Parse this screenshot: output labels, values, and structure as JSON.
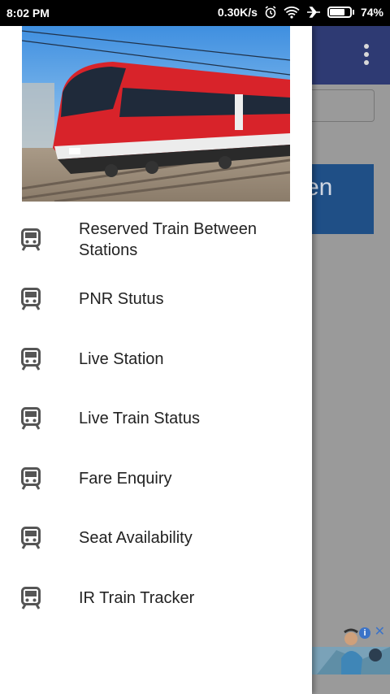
{
  "status_bar": {
    "time": "8:02 PM",
    "network_speed": "0.30K/s",
    "battery": "74%",
    "battery_level": 0.74
  },
  "background": {
    "button_fragment": "en"
  },
  "drawer": {
    "header_image": "train-photo",
    "items": [
      {
        "label": "Reserved Train Between Stations",
        "icon": "train-icon"
      },
      {
        "label": "PNR Stutus",
        "icon": "train-icon"
      },
      {
        "label": "Live Station",
        "icon": "train-icon"
      },
      {
        "label": "Live Train Status",
        "icon": "train-icon"
      },
      {
        "label": "Fare Enquiry",
        "icon": "train-icon"
      },
      {
        "label": "Seat Availability",
        "icon": "train-icon"
      },
      {
        "label": "IR Train Tracker",
        "icon": "train-icon"
      }
    ]
  },
  "colors": {
    "toolbar": "#2e3a73",
    "accent_button": "#1f4f86",
    "train_red": "#d8232a"
  }
}
